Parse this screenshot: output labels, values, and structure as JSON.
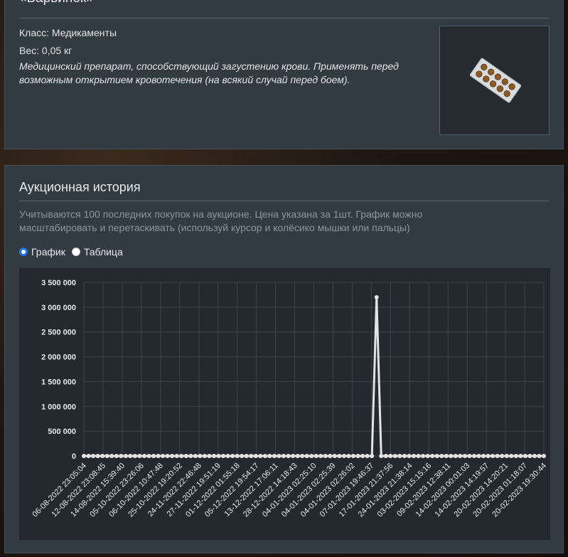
{
  "item": {
    "title": "«Барвинок»",
    "class_text": "Класс: Медикаменты",
    "weight_text": "Вес: 0,05 кг",
    "description": "Медицинский препарат, способствующий загустению крови. Применять перед возможным открытием кровотечения (на всякий случай перед боем).",
    "image_icon": "pill-blister-icon"
  },
  "auction": {
    "title": "Аукционная история",
    "hint": "Учитываются 100 последних покупок на аукционе. Цена указана за 1шт. График можно масштабировать и перетаскивать (используй курсор и колёсико мышки или пальцы)",
    "view_options": [
      {
        "label": "График",
        "selected": true
      },
      {
        "label": "Таблица",
        "selected": false
      }
    ]
  },
  "chart_data": {
    "type": "line",
    "ylim": [
      0,
      3500000
    ],
    "y_ticks": [
      0,
      500000,
      1000000,
      1500000,
      2000000,
      2500000,
      3000000,
      3500000
    ],
    "y_tick_labels": [
      "0",
      "500 000",
      "1 000 000",
      "1 500 000",
      "2 000 000",
      "2 500 000",
      "3 000 000",
      "3 500 000"
    ],
    "x_tick_labels": [
      "06-08-2022 23:05:04",
      "12-08-2022 23:08:45",
      "14-08-2022 15:39:40",
      "05-10-2022 23:26:06",
      "06-10-2022 10:47:48",
      "25-10-2022 19:20:52",
      "24-11-2022 22:46:48",
      "27-11-2022 19:51:19",
      "01-12-2022 01:55:18",
      "05-12-2022 19:54:17",
      "13-12-2022 17:06:11",
      "28-12-2022 14:18:43",
      "04-01-2023 02:25:10",
      "04-01-2023 02:25:39",
      "04-01-2023 02:26:02",
      "07-01-2023 19:46:37",
      "17-01-2023 21:37:56",
      "24-01-2023 21:38:14",
      "03-02-2023 15:15:16",
      "09-02-2023 12:38:11",
      "14-02-2023 00:01:03",
      "14-02-2023 14:19:57",
      "20-02-2023 14:20:21",
      "20-02-2023 01:18:07",
      "20-02-2023 19:30:44"
    ],
    "point_count": 100,
    "spike_index": 63,
    "spike_value": 3200000,
    "baseline_value": 0,
    "grid": true,
    "line_color": "#e3e3e3",
    "grid_color": "#3d444b",
    "background": "#23292f"
  }
}
